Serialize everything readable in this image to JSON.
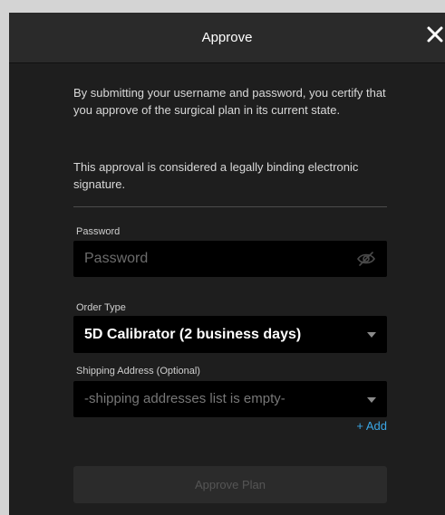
{
  "dialog": {
    "title": "Approve",
    "intro_paragraph_1": "By submitting your username and password, you certify that you approve of the surgical plan in its current state.",
    "intro_paragraph_2": "This approval is considered a legally binding electronic signature."
  },
  "password": {
    "label": "Password",
    "placeholder": "Password",
    "value": "",
    "toggle_icon": "eye-slash-icon"
  },
  "order_type": {
    "label": "Order Type",
    "selected": "5D Calibrator (2 business days)",
    "icon": "caret-down-icon"
  },
  "shipping": {
    "label": "Shipping Address (Optional)",
    "placeholder": "-shipping addresses list is empty-",
    "icon": "caret-down-icon",
    "add_label": "+ Add"
  },
  "actions": {
    "approve_label": "Approve Plan"
  },
  "colors": {
    "background": "#1e1e1e",
    "header": "#2a2a2a",
    "field": "#000000",
    "link": "#3aa7e6",
    "disabled_button": "#2b2b2b"
  }
}
